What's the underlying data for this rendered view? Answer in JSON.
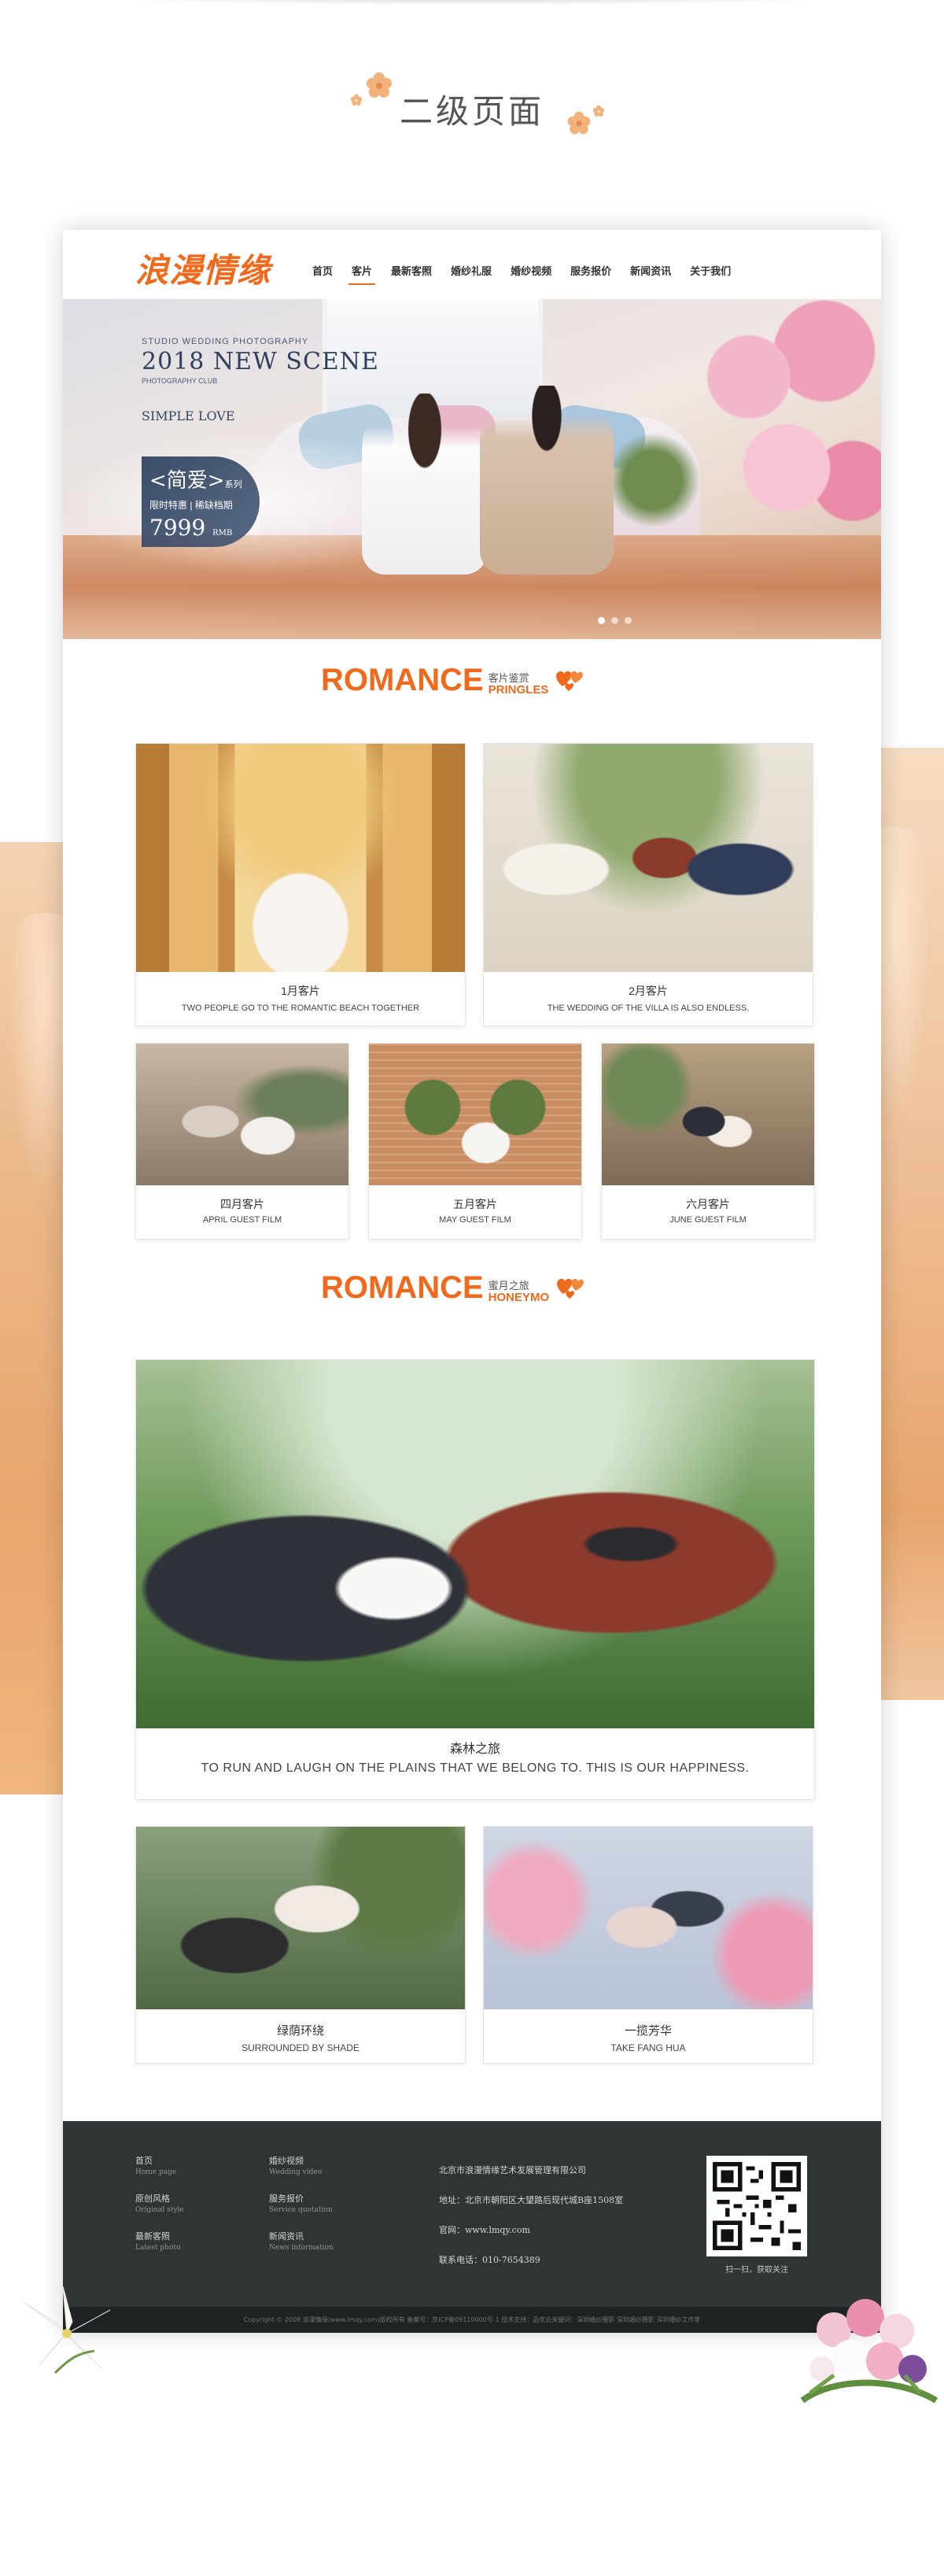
{
  "page_heading": "二级页面",
  "site": {
    "logo": "浪漫情缘",
    "nav": [
      "首页",
      "客片",
      "最新客照",
      "婚纱礼服",
      "婚纱视频",
      "服务报价",
      "新闻资讯",
      "关于我们"
    ],
    "active_nav": "客片"
  },
  "banner": {
    "kicker": "STUDIO WEDDING PHOTOGRAPHY",
    "title": "2018 NEW SCENE",
    "subtitle": "PHOTOGRAPHY CLUB",
    "tagline": "SIMPLE LOVE",
    "promo_title": "<简爱>",
    "promo_series": "系列",
    "promo_tag": "限时特惠 | 稀缺档期",
    "promo_price": "7999",
    "promo_unit": "RMB",
    "dots_count": 3
  },
  "section1": {
    "big": "ROMANCE",
    "cn": "客片鉴赏",
    "en": "PRINGLES",
    "cards_large": [
      {
        "cn": "1月客片",
        "en": "TWO PEOPLE GO TO THE ROMANTIC BEACH TOGETHER"
      },
      {
        "cn": "2月客片",
        "en": "THE WEDDING OF THE VILLA IS ALSO ENDLESS."
      }
    ],
    "cards_small": [
      {
        "cn": "四月客片",
        "en": "APRIL GUEST FILM"
      },
      {
        "cn": "五月客片",
        "en": "MAY GUEST FILM"
      },
      {
        "cn": "六月客片",
        "en": "JUNE GUEST FILM"
      }
    ]
  },
  "section2": {
    "big": "ROMANCE",
    "cn": "蜜月之旅",
    "en": "HONEYMO",
    "feature": {
      "cn": "森林之旅",
      "en": "TO RUN AND LAUGH ON THE PLAINS THAT WE BELONG TO. THIS IS OUR HAPPINESS."
    },
    "cards": [
      {
        "cn": "绿荫环绕",
        "en": "SURROUNDED BY SHADE"
      },
      {
        "cn": "一揽芳华",
        "en": "TAKE FANG HUA"
      }
    ]
  },
  "footer": {
    "col1": [
      {
        "cn": "首页",
        "en": "Home page"
      },
      {
        "cn": "原创风格",
        "en": "Original style"
      },
      {
        "cn": "最新客照",
        "en": "Latest photo"
      }
    ],
    "col2": [
      {
        "cn": "婚纱视频",
        "en": "Wedding video"
      },
      {
        "cn": "服务报价",
        "en": "Service quotation"
      },
      {
        "cn": "新闻资讯",
        "en": "News information"
      }
    ],
    "company": "北京市浪漫情缘艺术发展管理有限公司",
    "address": "地址：北京市朝阳区大望路后现代城B座1508室",
    "website": "官网：www.lmqy.com",
    "phone": "联系电话：010-7654389",
    "qr_caption": "扫一扫，获取关注",
    "copyright": "Copyright © 2008 浪漫情缘(www.lmqy.com)版权所有 备案号：京ICP备09110000号-1 技术支持：品优云关键词：深圳婚纱摄影 深圳婚纱摄影 深圳婚纱工作室"
  },
  "colors": {
    "accent": "#f06a1d",
    "footer_bg": "#2f3434",
    "copyright_bg": "#1d2222"
  }
}
